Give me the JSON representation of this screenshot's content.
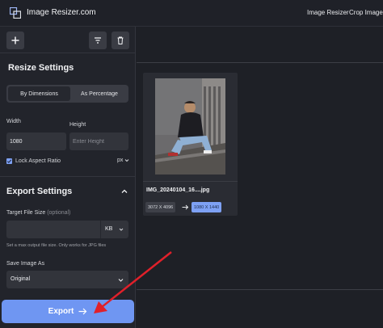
{
  "header": {
    "brand": "Image Resizer.com",
    "logo_icon": "frame-corners-icon",
    "nav": [
      "Image Resizer",
      "Crop Image"
    ]
  },
  "toolbar": {
    "add_icon": "plus-icon",
    "filter_icon": "filter-icon",
    "delete_icon": "trash-icon"
  },
  "resize": {
    "title": "Resize Settings",
    "mode_options": [
      "By Dimensions",
      "As Percentage"
    ],
    "selected_mode": "By Dimensions",
    "width_label": "Width",
    "width_value": "1080",
    "height_label": "Height",
    "height_placeholder": "Enter Height",
    "lock_label": "Lock Aspect Ratio",
    "lock_checked": true,
    "unit": "px"
  },
  "export_settings": {
    "title": "Export Settings",
    "target_label": "Target File Size",
    "target_optional": "(optional)",
    "target_unit": "KB",
    "hint": "Set a max output file size. Only works for JPG files",
    "save_as_label": "Save Image As",
    "save_as_value": "Original"
  },
  "export_button": {
    "label": "Export",
    "icon": "arrow-right-icon"
  },
  "file": {
    "name": "IMG_20240104_16....jpg",
    "original_dims": "3072 X 4096",
    "new_dims": "1080 X 1440"
  },
  "colors": {
    "background": "#1e2026",
    "sidebar": "#22242b",
    "accent": "#6f96f2",
    "annotation_arrow": "#e0202a"
  }
}
